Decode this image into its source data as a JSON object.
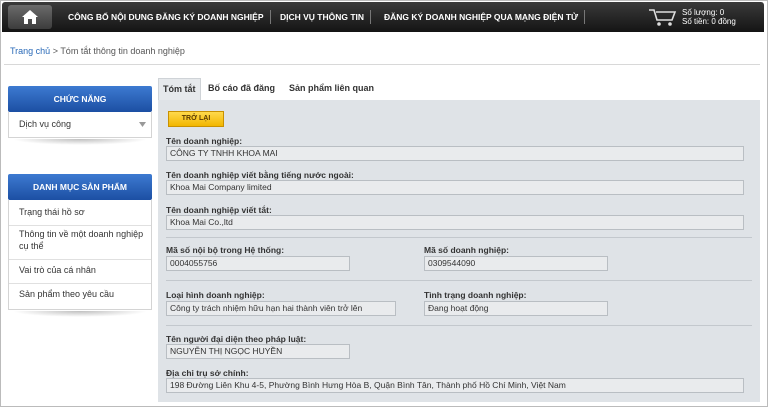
{
  "nav": {
    "items": [
      "CÔNG BỐ NỘI DUNG ĐĂNG KÝ DOANH NGHIỆP",
      "DỊCH VỤ THÔNG TIN",
      "ĐĂNG KÝ DOANH NGHIỆP QUA MẠNG ĐIỆN TỬ"
    ],
    "cart_quantity": "Số lượng: 0",
    "cart_amount": "Số tiền: 0 đồng"
  },
  "breadcrumb": {
    "home": "Trang chủ",
    "separator": " > ",
    "current": "Tóm tắt thông tin doanh nghiệp"
  },
  "sidebar": {
    "functions_title": "CHỨC NĂNG",
    "functions_item": "Dịch vụ công",
    "products_title": "DANH MỤC SẢN PHẨM",
    "products": [
      "Trạng thái hồ sơ",
      "Thông tin về một doanh nghiệp cụ thể",
      "Vai trò của cá nhân",
      "Sản phẩm theo yêu cầu"
    ]
  },
  "tabs": [
    "Tóm tắt",
    "Bố cáo đã đăng",
    "Sản phẩm liên quan"
  ],
  "back_label": "TRỞ LẠI",
  "form": {
    "name_label": "Tên doanh nghiệp:",
    "name_value": "CÔNG TY TNHH KHOA MAI",
    "foreign_name_label": "Tên doanh nghiệp viết bằng tiếng nước ngoài:",
    "foreign_name_value": "Khoa Mai Company limited",
    "short_name_label": "Tên doanh nghiệp viết tắt:",
    "short_name_value": "Khoa Mai Co.,ltd",
    "internal_id_label": "Mã số nội bộ trong Hệ thống:",
    "internal_id_value": "0004055756",
    "tax_id_label": "Mã số doanh nghiệp:",
    "tax_id_value": "0309544090",
    "type_label": "Loại hình doanh nghiệp:",
    "type_value": "Công ty trách nhiệm hữu hạn hai thành viên trở lên",
    "status_label": "Tình trạng doanh nghiệp:",
    "status_value": "Đang hoạt động",
    "rep_label": "Tên người đại diện theo pháp luật:",
    "rep_value": "NGUYỄN THỊ NGỌC HUYỀN",
    "address_label": "Địa chỉ trụ sở chính:",
    "address_value": "198 Đường Liên Khu 4-5, Phường Bình Hưng Hòa B, Quận Bình Tân, Thành phố Hồ Chí Minh, Việt Nam"
  },
  "colors": {
    "accent_blue": "#1c4fa3",
    "button_yellow": "#f2b600",
    "panel_bg": "#dfe3e7"
  }
}
